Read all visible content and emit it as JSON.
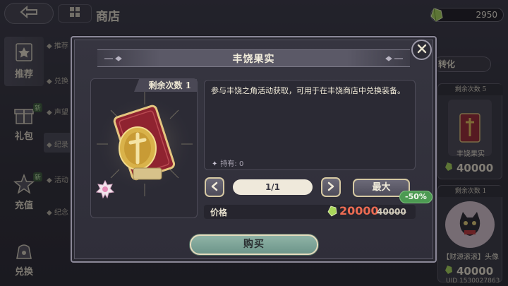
{
  "top_bar": {
    "title": "商店",
    "currency_amount": "2950",
    "currency_icon": "green-crystal-icon"
  },
  "sidebar": {
    "items": [
      {
        "label": "推荐",
        "icon": "star-badge-icon",
        "new": ""
      },
      {
        "label": "礼包",
        "icon": "gift-icon",
        "new": "新"
      },
      {
        "label": "充值",
        "icon": "star-icon",
        "new": "新"
      },
      {
        "label": "兑换",
        "icon": "bag-icon",
        "new": ""
      }
    ]
  },
  "subnav": {
    "items": [
      "◆ 推荐",
      "◆ 兑换",
      "◆ 声望",
      "◆ 纪录",
      "◆ 活动",
      "◆ 纪念"
    ]
  },
  "background_cards": [
    {
      "remaining": "剩余次数 5",
      "name": "丰饶果实",
      "price": "40000"
    },
    {
      "remaining": "剩余次数 1",
      "name": "【财源滚滚】头像",
      "price": "40000"
    }
  ],
  "convert_label": "转化",
  "uid": "UID 1530027863",
  "modal": {
    "title": "丰饶果实",
    "remaining_label": "剩余次数 1",
    "description": "参与丰饶之角活动获取，可用于在丰饶商店中兑换装备。",
    "owned": "持有: 0",
    "quantity": "1/1",
    "max_label": "最大",
    "discount": "-50%",
    "price_label": "价格",
    "price_now": "20000",
    "price_old": "40000",
    "buy_label": "购买"
  },
  "colors": {
    "accent_red": "#ec6b52",
    "discount_green": "#4c9a52",
    "buy_button": "#7fa69a"
  }
}
